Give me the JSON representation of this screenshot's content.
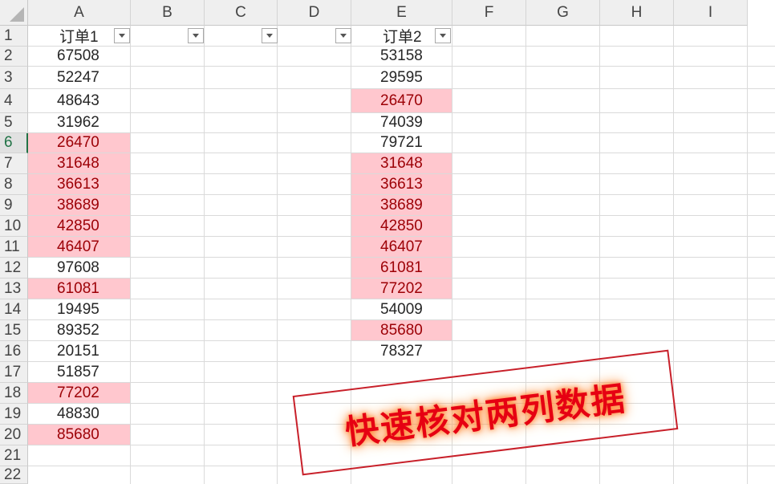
{
  "columns": [
    "A",
    "B",
    "C",
    "D",
    "E",
    "F",
    "G",
    "H",
    "I"
  ],
  "rows": [
    "1",
    "2",
    "3",
    "4",
    "5",
    "6",
    "7",
    "8",
    "9",
    "10",
    "11",
    "12",
    "13",
    "14",
    "15",
    "16",
    "17",
    "18",
    "19",
    "20",
    "21",
    "22"
  ],
  "active_row": "6",
  "header_a": "订单1",
  "header_e": "订单2",
  "col_a": [
    {
      "v": "67508",
      "hl": false
    },
    {
      "v": "52247",
      "hl": false
    },
    {
      "v": "48643",
      "hl": false
    },
    {
      "v": "31962",
      "hl": false
    },
    {
      "v": "26470",
      "hl": true
    },
    {
      "v": "31648",
      "hl": true
    },
    {
      "v": "36613",
      "hl": true
    },
    {
      "v": "38689",
      "hl": true
    },
    {
      "v": "42850",
      "hl": true
    },
    {
      "v": "46407",
      "hl": true
    },
    {
      "v": "97608",
      "hl": false
    },
    {
      "v": "61081",
      "hl": true
    },
    {
      "v": "19495",
      "hl": false
    },
    {
      "v": "89352",
      "hl": false
    },
    {
      "v": "20151",
      "hl": false
    },
    {
      "v": "51857",
      "hl": false
    },
    {
      "v": "77202",
      "hl": true
    },
    {
      "v": "48830",
      "hl": false
    },
    {
      "v": "85680",
      "hl": true
    }
  ],
  "col_e": [
    {
      "v": "53158",
      "hl": false
    },
    {
      "v": "29595",
      "hl": false
    },
    {
      "v": "26470",
      "hl": true
    },
    {
      "v": "74039",
      "hl": false
    },
    {
      "v": "79721",
      "hl": false
    },
    {
      "v": "31648",
      "hl": true
    },
    {
      "v": "36613",
      "hl": true
    },
    {
      "v": "38689",
      "hl": true
    },
    {
      "v": "42850",
      "hl": true
    },
    {
      "v": "46407",
      "hl": true
    },
    {
      "v": "61081",
      "hl": true
    },
    {
      "v": "77202",
      "hl": true
    },
    {
      "v": "54009",
      "hl": false
    },
    {
      "v": "85680",
      "hl": true
    },
    {
      "v": "78327",
      "hl": false
    }
  ],
  "stamp_text": "快速核对两列数据",
  "colors": {
    "highlight_fill": "#ffc7ce",
    "highlight_text": "#9c0006",
    "stamp": "#e60012",
    "glow": "#ff8a3d"
  },
  "icons": {
    "filter_dropdown": "chevron-down-icon",
    "select_all": "select-all-triangle-icon"
  }
}
